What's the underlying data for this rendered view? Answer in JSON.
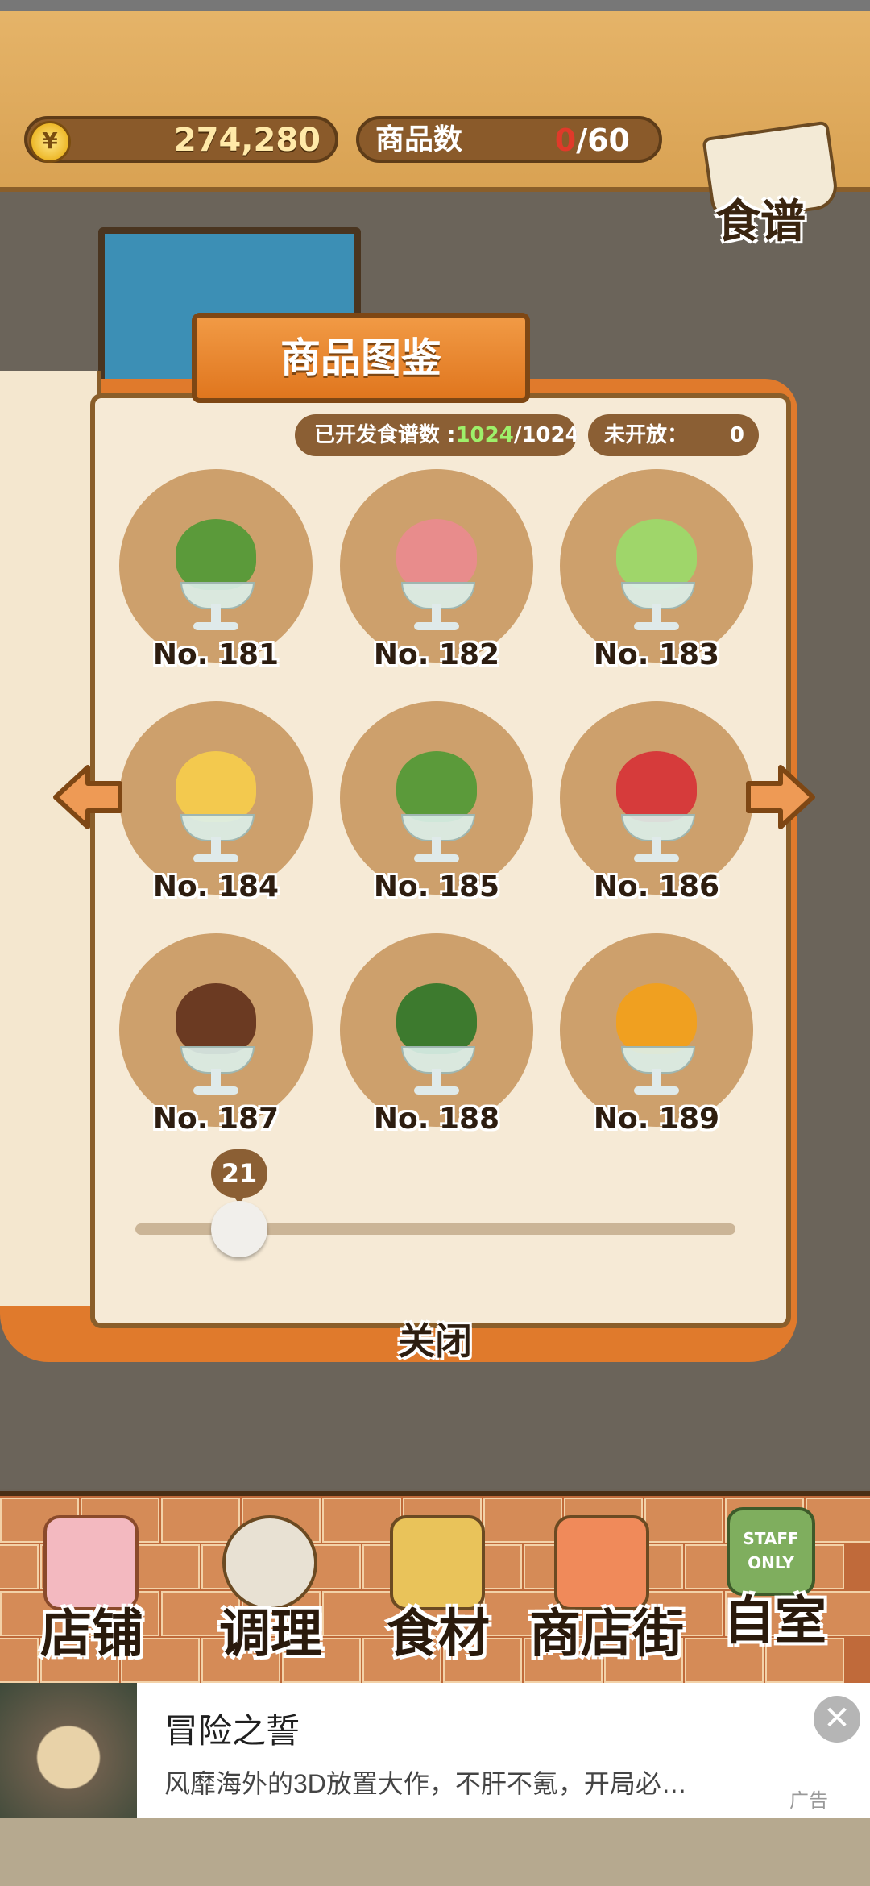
{
  "header": {
    "currency_symbol": "¥",
    "money": "274,280",
    "products_label": "商品数",
    "products_current": "0",
    "products_max": "/60",
    "recipe_label": "食谱"
  },
  "dialog": {
    "title": "商品图鉴",
    "developed_label": "已开发食谱数 :",
    "developed_current": "1024",
    "developed_total": "/1024",
    "unopened_label": "未开放：",
    "unopened_value": "0",
    "items": [
      {
        "label": "No. 181",
        "color": "#5b9a3a"
      },
      {
        "label": "No. 182",
        "color": "#e88c8c"
      },
      {
        "label": "No. 183",
        "color": "#9fd66a"
      },
      {
        "label": "No. 184",
        "color": "#f3c94e"
      },
      {
        "label": "No. 185",
        "color": "#5b9a3a"
      },
      {
        "label": "No. 186",
        "color": "#d63b3b"
      },
      {
        "label": "No. 187",
        "color": "#6b3a22"
      },
      {
        "label": "No. 188",
        "color": "#3d7a2e"
      },
      {
        "label": "No. 189",
        "color": "#f0a020"
      }
    ],
    "slider_value": "21",
    "close_label": "关闭"
  },
  "nav": {
    "shop": "店铺",
    "cook": "调理",
    "ingredients": "食材",
    "street": "商店街",
    "home": "自室",
    "staff_sign": "STAFF ONLY"
  },
  "ad": {
    "title": "冒险之誓",
    "description": "风靡海外的3D放置大作，不肝不氪，开局必…",
    "tag": "广告",
    "close": "✕"
  }
}
